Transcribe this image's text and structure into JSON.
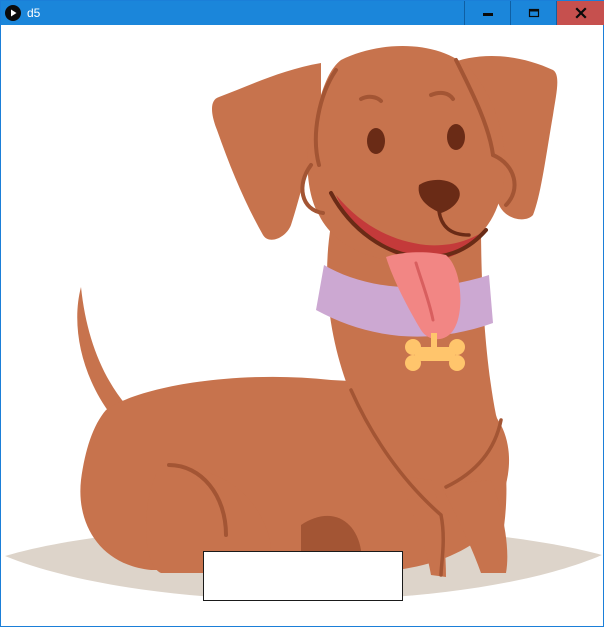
{
  "window": {
    "title": "d5",
    "colors": {
      "titlebar": "#1b86da",
      "close": "#c6504e"
    },
    "icons": {
      "app": "play-circle-icon",
      "minimize": "minimize-icon",
      "maximize": "maximize-icon",
      "close": "close-icon"
    }
  },
  "canvas": {
    "illustration": "cartoon-dog",
    "colors": {
      "fur": "#c7734d",
      "fur_dark": "#a35534",
      "collar": "#cca8d2",
      "tag": "#ffc56c",
      "tongue": "#f28684",
      "mouth": "#c43a3a",
      "shadow": "#ddd4ca"
    },
    "box_text": ""
  }
}
